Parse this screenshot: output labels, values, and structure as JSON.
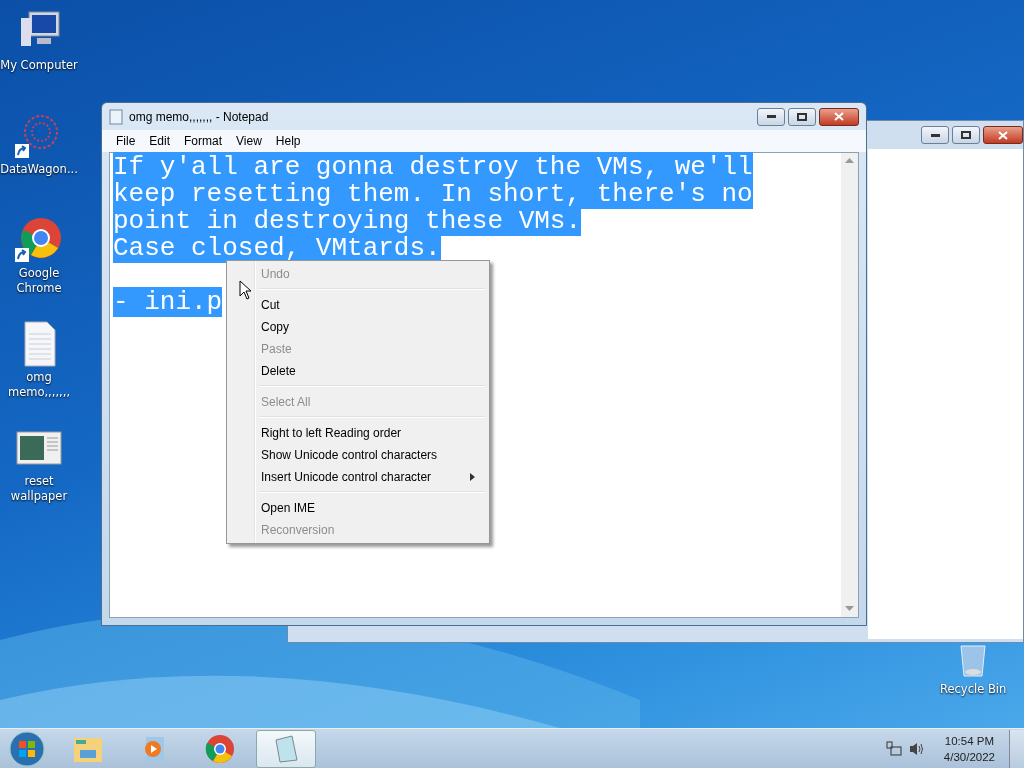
{
  "desktop_icons": [
    {
      "label": "My Computer",
      "kind": "computer",
      "shortcut": false
    },
    {
      "label": "DataWagon...",
      "kind": "web",
      "shortcut": true
    },
    {
      "label": "Google Chrome",
      "kind": "chrome",
      "shortcut": true
    },
    {
      "label": "omg memo,,,,,,,",
      "kind": "text",
      "shortcut": false
    },
    {
      "label": "reset wallpaper",
      "kind": "wallpaper",
      "shortcut": false
    }
  ],
  "recycle_bin": {
    "label": "Recycle Bin"
  },
  "notepad": {
    "title": "omg memo,,,,,,, - Notepad",
    "menu": [
      "File",
      "Edit",
      "Format",
      "View",
      "Help"
    ],
    "lines": [
      {
        "text": "If y'all are gonna destroy the VMs, we'll",
        "selected": true
      },
      {
        "text": "keep resetting them. In short, there's no",
        "selected": true
      },
      {
        "text": "point in destroying these VMs.",
        "selected": true
      },
      {
        "text": "Case closed, VMtards.",
        "selected": true
      },
      {
        "kind": "blank"
      },
      {
        "text": "- ini.p",
        "selected": true
      }
    ]
  },
  "context_menu": [
    {
      "kind": "item",
      "label": "Undo",
      "disabled": true
    },
    {
      "kind": "separator"
    },
    {
      "kind": "item",
      "label": "Cut",
      "disabled": false
    },
    {
      "kind": "item",
      "label": "Copy",
      "disabled": false
    },
    {
      "kind": "item",
      "label": "Paste",
      "disabled": true
    },
    {
      "kind": "item",
      "label": "Delete",
      "disabled": false
    },
    {
      "kind": "separator"
    },
    {
      "kind": "item",
      "label": "Select All",
      "disabled": true
    },
    {
      "kind": "separator"
    },
    {
      "kind": "item",
      "label": "Right to left Reading order",
      "disabled": false
    },
    {
      "kind": "item",
      "label": "Show Unicode control characters",
      "disabled": false
    },
    {
      "kind": "item",
      "label": "Insert Unicode control character",
      "disabled": false,
      "submenu": true
    },
    {
      "kind": "separator"
    },
    {
      "kind": "item",
      "label": "Open IME",
      "disabled": false
    },
    {
      "kind": "item",
      "label": "Reconversion",
      "disabled": true
    }
  ],
  "taskbar": [
    {
      "kind": "explorer",
      "active": false
    },
    {
      "kind": "media",
      "active": false
    },
    {
      "kind": "chrome",
      "active": false
    },
    {
      "kind": "notepad",
      "active": true
    }
  ],
  "tray": {
    "time": "10:54 PM",
    "date": "4/30/2022"
  }
}
